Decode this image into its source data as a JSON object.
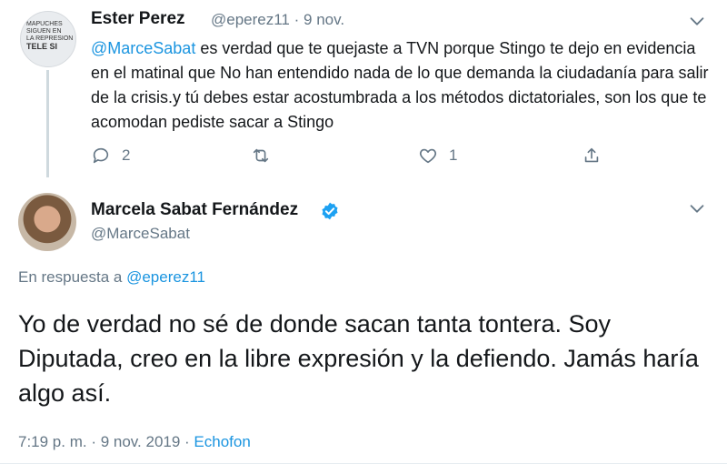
{
  "reply_tweet": {
    "author_name": "Ester Perez",
    "handle": "@eperez11",
    "separator": "·",
    "date": "9 nov.",
    "mention": "@MarceSabat",
    "text": " es verdad que te quejaste a TVN porque Stingo te dejo en evidencia en el matinal que No han entendido nada de lo que demanda la ciudadanía para salir de la crisis.y tú debes estar acostumbrada a los métodos dictatoriales, son los que te acomodan pediste sacar a Stingo",
    "reply_count": "2",
    "like_count": "1",
    "avatar_sign_text": [
      "MAPUCHES",
      "SIGUEN EN",
      "LA REPRESION",
      "TELE SI"
    ],
    "icons": {
      "menu": "chevron-down-icon",
      "reply": "reply-bubble-icon",
      "retweet": "retweet-icon",
      "like": "heart-icon",
      "share": "share-icon"
    }
  },
  "main_tweet": {
    "author_name": "Marcela Sabat Fernández",
    "handle": "@MarceSabat",
    "verified": true,
    "reply_prefix": "En respuesta a ",
    "reply_handle": "@eperez11",
    "text": "Yo de verdad no sé de donde sacan tanta tontera. Soy Diputada, creo en la libre expresión y la defiendo. Jamás haría algo así.",
    "time": "7:19 p. m.",
    "separator": " · ",
    "date": "9 nov. 2019",
    "separator2": " · ",
    "source": "Echofon",
    "icons": {
      "menu": "chevron-down-icon",
      "verified": "verified-badge-icon"
    }
  },
  "colors": {
    "link": "#1b95e0",
    "secondary": "#657786",
    "text": "#14171a",
    "verified": "#1da1f2"
  }
}
